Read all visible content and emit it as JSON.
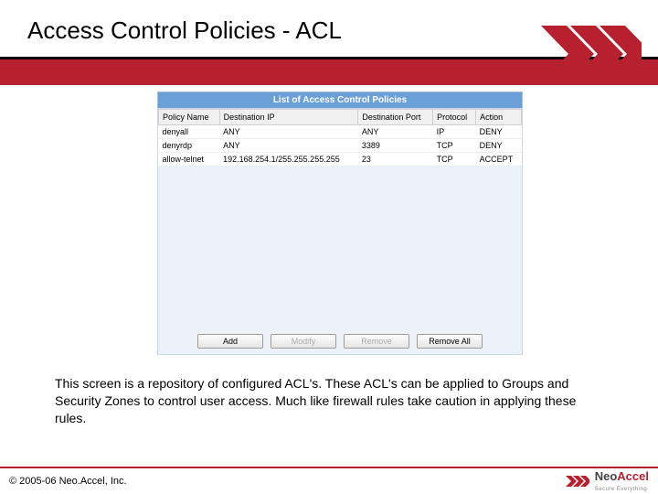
{
  "title": "Access Control Policies - ACL",
  "panel": {
    "heading": "List of Access Control Policies",
    "columns": [
      "Policy Name",
      "Destination IP",
      "Destination Port",
      "Protocol",
      "Action"
    ],
    "rows": [
      {
        "name": "denyall",
        "dest_ip": "ANY",
        "dest_port": "ANY",
        "protocol": "IP",
        "action": "DENY"
      },
      {
        "name": "denyrdp",
        "dest_ip": "ANY",
        "dest_port": "3389",
        "protocol": "TCP",
        "action": "DENY"
      },
      {
        "name": "allow-telnet",
        "dest_ip": "192.168.254.1/255.255.255.255",
        "dest_port": "23",
        "protocol": "TCP",
        "action": "ACCEPT"
      }
    ],
    "buttons": {
      "add": "Add",
      "modify": "Modify",
      "remove": "Remove",
      "remove_all": "Remove All"
    }
  },
  "caption": "This screen is a repository of configured ACL's. These ACL's can be applied to Groups and Security Zones to control user access. Much like firewall rules take caution in applying these rules.",
  "footer": {
    "copyright": "© 2005-06 Neo.Accel, Inc.",
    "brand_neo": "Neo",
    "brand_accel": "Accel",
    "tagline": "Secure Everything"
  }
}
